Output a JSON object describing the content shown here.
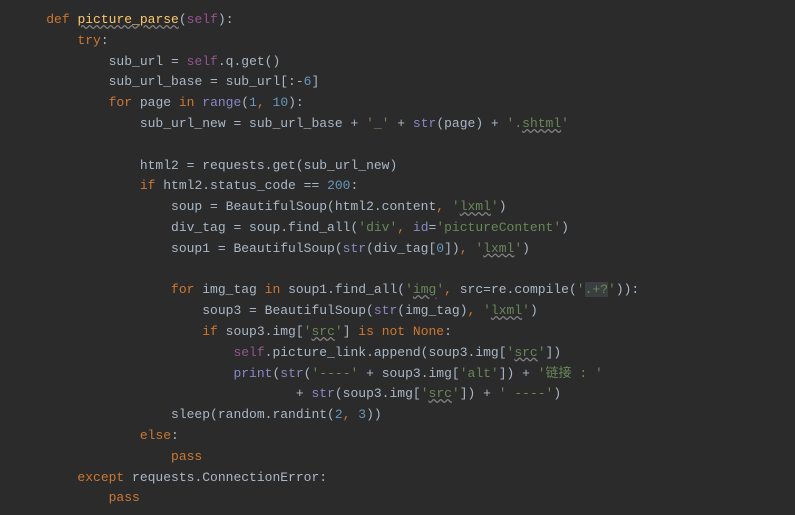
{
  "lines": [
    {
      "indent": 1,
      "tokens": [
        {
          "t": "def ",
          "c": "kw-def"
        },
        {
          "t": "picture_parse",
          "c": "func-name"
        },
        {
          "t": "(",
          "c": "paren"
        },
        {
          "t": "self",
          "c": "self"
        },
        {
          "t": "):",
          "c": "paren"
        }
      ]
    },
    {
      "indent": 2,
      "tokens": [
        {
          "t": "try",
          "c": "kw-orange"
        },
        {
          "t": ":",
          "c": "paren"
        }
      ]
    },
    {
      "indent": 3,
      "tokens": [
        {
          "t": "sub_url = ",
          "c": "ident"
        },
        {
          "t": "self",
          "c": "self"
        },
        {
          "t": ".q.get()",
          "c": "ident"
        }
      ]
    },
    {
      "indent": 3,
      "tokens": [
        {
          "t": "sub_url_base = sub_url[:-",
          "c": "ident"
        },
        {
          "t": "6",
          "c": "number"
        },
        {
          "t": "]",
          "c": "ident"
        }
      ]
    },
    {
      "indent": 3,
      "tokens": [
        {
          "t": "for ",
          "c": "kw-orange"
        },
        {
          "t": "page ",
          "c": "ident"
        },
        {
          "t": "in ",
          "c": "kw-orange"
        },
        {
          "t": "range",
          "c": "builtin"
        },
        {
          "t": "(",
          "c": "paren"
        },
        {
          "t": "1",
          "c": "number"
        },
        {
          "t": ", ",
          "c": "comma"
        },
        {
          "t": "10",
          "c": "number"
        },
        {
          "t": "):",
          "c": "paren"
        }
      ]
    },
    {
      "indent": 4,
      "tokens": [
        {
          "t": "sub_url_new = sub_url_base + ",
          "c": "ident"
        },
        {
          "t": "'_' ",
          "c": "string"
        },
        {
          "t": "+ ",
          "c": "ident"
        },
        {
          "t": "str",
          "c": "builtin"
        },
        {
          "t": "(page) + ",
          "c": "ident"
        },
        {
          "t": "'.",
          "c": "string"
        },
        {
          "t": "shtml",
          "c": "string-warn"
        },
        {
          "t": "'",
          "c": "string"
        }
      ]
    },
    {
      "indent": 0,
      "tokens": [
        {
          "t": " ",
          "c": "ident"
        }
      ]
    },
    {
      "indent": 4,
      "tokens": [
        {
          "t": "html2 = requests.get(sub_url_new)",
          "c": "ident"
        }
      ]
    },
    {
      "indent": 4,
      "tokens": [
        {
          "t": "if ",
          "c": "kw-orange"
        },
        {
          "t": "html2.status_code == ",
          "c": "ident"
        },
        {
          "t": "200",
          "c": "number"
        },
        {
          "t": ":",
          "c": "paren"
        }
      ]
    },
    {
      "indent": 5,
      "tokens": [
        {
          "t": "soup = BeautifulSoup(html2.content",
          "c": "ident"
        },
        {
          "t": ", ",
          "c": "comma"
        },
        {
          "t": "'",
          "c": "string"
        },
        {
          "t": "lxml",
          "c": "string-warn"
        },
        {
          "t": "'",
          "c": "string"
        },
        {
          "t": ")",
          "c": "paren"
        }
      ]
    },
    {
      "indent": 5,
      "tokens": [
        {
          "t": "div_tag = soup.find_all(",
          "c": "ident"
        },
        {
          "t": "'div'",
          "c": "string"
        },
        {
          "t": ", ",
          "c": "comma"
        },
        {
          "t": "id",
          "c": "builtin"
        },
        {
          "t": "=",
          "c": "ident"
        },
        {
          "t": "'pictureContent'",
          "c": "string"
        },
        {
          "t": ")",
          "c": "paren"
        }
      ]
    },
    {
      "indent": 5,
      "tokens": [
        {
          "t": "soup1 = BeautifulSoup(",
          "c": "ident"
        },
        {
          "t": "str",
          "c": "builtin"
        },
        {
          "t": "(div_tag[",
          "c": "ident"
        },
        {
          "t": "0",
          "c": "number"
        },
        {
          "t": "])",
          "c": "ident"
        },
        {
          "t": ", ",
          "c": "comma"
        },
        {
          "t": "'",
          "c": "string"
        },
        {
          "t": "lxml",
          "c": "string-warn"
        },
        {
          "t": "'",
          "c": "string"
        },
        {
          "t": ")",
          "c": "paren"
        }
      ]
    },
    {
      "indent": 0,
      "tokens": [
        {
          "t": " ",
          "c": "ident"
        }
      ]
    },
    {
      "indent": 5,
      "tokens": [
        {
          "t": "for ",
          "c": "kw-orange"
        },
        {
          "t": "img_tag ",
          "c": "ident"
        },
        {
          "t": "in ",
          "c": "kw-orange"
        },
        {
          "t": "soup1.find_all(",
          "c": "ident"
        },
        {
          "t": "'",
          "c": "string"
        },
        {
          "t": "img",
          "c": "string-warn"
        },
        {
          "t": "'",
          "c": "string"
        },
        {
          "t": ", ",
          "c": "comma"
        },
        {
          "t": "src",
          "c": "ident"
        },
        {
          "t": "=re.compile(",
          "c": "ident"
        },
        {
          "t": "'",
          "c": "string"
        },
        {
          "t": ".+?",
          "c": "string-bg"
        },
        {
          "t": "'",
          "c": "string"
        },
        {
          "t": ")):",
          "c": "paren"
        }
      ]
    },
    {
      "indent": 6,
      "tokens": [
        {
          "t": "soup3 = BeautifulSoup(",
          "c": "ident"
        },
        {
          "t": "str",
          "c": "builtin"
        },
        {
          "t": "(img_tag)",
          "c": "ident"
        },
        {
          "t": ", ",
          "c": "comma"
        },
        {
          "t": "'",
          "c": "string"
        },
        {
          "t": "lxml",
          "c": "string-warn"
        },
        {
          "t": "'",
          "c": "string"
        },
        {
          "t": ")",
          "c": "paren"
        }
      ]
    },
    {
      "indent": 6,
      "tokens": [
        {
          "t": "if ",
          "c": "kw-orange"
        },
        {
          "t": "soup3.img[",
          "c": "ident"
        },
        {
          "t": "'",
          "c": "string"
        },
        {
          "t": "src",
          "c": "string-warn"
        },
        {
          "t": "'",
          "c": "string"
        },
        {
          "t": "] ",
          "c": "ident"
        },
        {
          "t": "is not ",
          "c": "kw-orange"
        },
        {
          "t": "None",
          "c": "kw-orange"
        },
        {
          "t": ":",
          "c": "paren"
        }
      ]
    },
    {
      "indent": 7,
      "tokens": [
        {
          "t": "self",
          "c": "self"
        },
        {
          "t": ".picture_link.append(soup3.img[",
          "c": "ident"
        },
        {
          "t": "'",
          "c": "string"
        },
        {
          "t": "src",
          "c": "string-warn"
        },
        {
          "t": "'",
          "c": "string"
        },
        {
          "t": "])",
          "c": "ident"
        }
      ]
    },
    {
      "indent": 7,
      "tokens": [
        {
          "t": "print",
          "c": "builtin"
        },
        {
          "t": "(",
          "c": "paren"
        },
        {
          "t": "str",
          "c": "builtin"
        },
        {
          "t": "(",
          "c": "paren"
        },
        {
          "t": "'----' ",
          "c": "string"
        },
        {
          "t": "+ soup3.img[",
          "c": "ident"
        },
        {
          "t": "'alt'",
          "c": "string"
        },
        {
          "t": "]) + ",
          "c": "ident"
        },
        {
          "t": "'链接 : '",
          "c": "string"
        }
      ]
    },
    {
      "indent": 9,
      "tokens": [
        {
          "t": "+ ",
          "c": "ident"
        },
        {
          "t": "str",
          "c": "builtin"
        },
        {
          "t": "(soup3.img[",
          "c": "ident"
        },
        {
          "t": "'",
          "c": "string"
        },
        {
          "t": "src",
          "c": "string-warn"
        },
        {
          "t": "'",
          "c": "string"
        },
        {
          "t": "]) + ",
          "c": "ident"
        },
        {
          "t": "' ----'",
          "c": "string"
        },
        {
          "t": ")",
          "c": "paren"
        }
      ]
    },
    {
      "indent": 5,
      "tokens": [
        {
          "t": "sleep(random.randint(",
          "c": "ident"
        },
        {
          "t": "2",
          "c": "number"
        },
        {
          "t": ", ",
          "c": "comma"
        },
        {
          "t": "3",
          "c": "number"
        },
        {
          "t": "))",
          "c": "paren"
        }
      ]
    },
    {
      "indent": 4,
      "tokens": [
        {
          "t": "else",
          "c": "kw-orange"
        },
        {
          "t": ":",
          "c": "paren"
        }
      ]
    },
    {
      "indent": 5,
      "tokens": [
        {
          "t": "pass",
          "c": "kw-orange"
        }
      ]
    },
    {
      "indent": 2,
      "tokens": [
        {
          "t": "except ",
          "c": "kw-orange"
        },
        {
          "t": "requests.ConnectionError:",
          "c": "ident"
        }
      ]
    },
    {
      "indent": 3,
      "tokens": [
        {
          "t": "pass",
          "c": "kw-orange"
        }
      ]
    }
  ],
  "indentUnit": "    "
}
